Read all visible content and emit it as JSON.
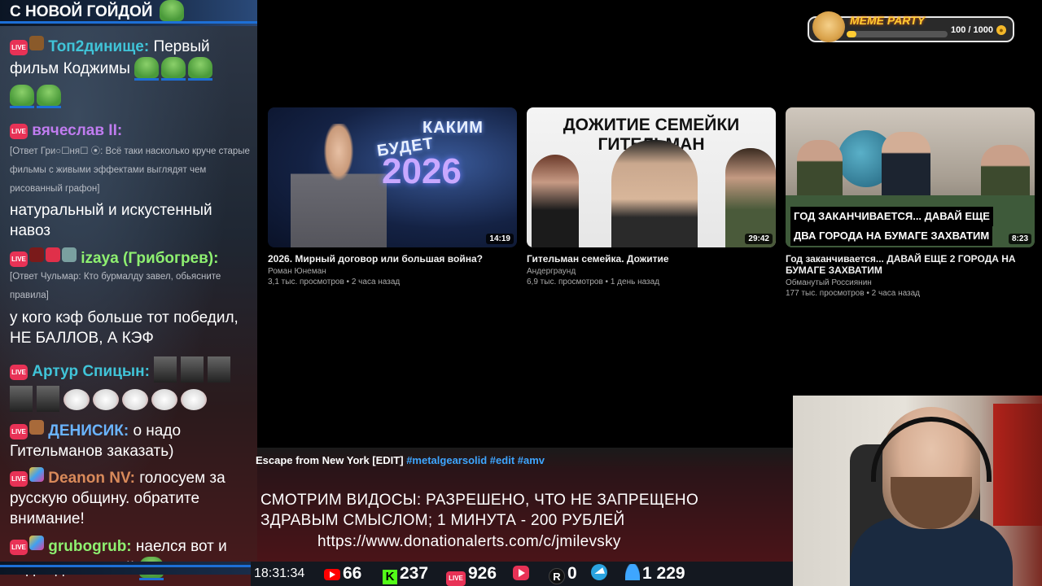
{
  "chat": {
    "pinned": "С НОВОЙ ГОЙДОЙ",
    "live_badge": "LIVE",
    "messages": [
      {
        "user": "Топ2динище:",
        "user_color": "#40c4d8",
        "text": "Первый фильм Коджимы"
      },
      {
        "user": "вячеслав II:",
        "user_color": "#c07cf0",
        "text": ""
      },
      {
        "reply": "[Ответ Гри○☐ня☐ ⦿: Всё таки насколько круче старые фильмы с живыми эффектами выглядят чем рисованный графон]",
        "text": "натуральный и искустенный навоз"
      },
      {
        "user": "izaya (Грибогрев):",
        "user_color": "#8ef070",
        "text": ""
      },
      {
        "reply": "[Ответ Чульмар: Кто бурмалду завел, обьясните правила]",
        "text": "у кого кэф больше тот победил, НЕ БАЛЛОВ, А КЭФ"
      },
      {
        "user": "Артур Спицын:",
        "user_color": "#40c4d8",
        "text": ""
      },
      {
        "user": "ДЕНИСИК:",
        "user_color": "#6ab4ff",
        "text": "о надо Гительманов заказать)"
      },
      {
        "user": "Deanon NV:",
        "user_color": "#d98a5a",
        "text": "голосуем за русскую общину. обратите внимание!"
      },
      {
        "user": "grubogrub:",
        "user_color": "#8ef070",
        "text": "наелся вот и сидит довольный"
      }
    ]
  },
  "meme_party": {
    "title": "MEME PARTY",
    "count": "100 / 1000",
    "progress": 0.1,
    "coin_icon": "coin-icon"
  },
  "videos": [
    {
      "title": "2026. Мирный договор или большая война?",
      "channel": "Роман Юнеман",
      "meta": "3,1 тыс. просмотров • 2 часа назад",
      "duration": "14:19",
      "thumb_text_1": "КАКИМ",
      "thumb_text_2": "БУДЕТ",
      "thumb_text_3": "2026"
    },
    {
      "title": "Гительман семейка. Дожитие",
      "channel": "Андерграунд",
      "meta": "6,9 тыс. просмотров • 1 день назад",
      "duration": "29:42",
      "thumb_text_1": "ДОЖИТИЕ СЕМЕЙКИ ГИТЕЛЬМАН"
    },
    {
      "title": "Год заканчивается... ДАВАЙ ЕЩЕ 2 ГОРОДА НА БУМАГЕ ЗАХВАТИМ",
      "channel": "Обманутый Россиянин",
      "meta": "177 тыс. просмотров • 2 часа назад",
      "duration": "8:23",
      "thumb_text_1": "ГОД ЗАКАНЧИВАЕТСЯ... ДАВАЙ ЕЩЕ",
      "thumb_text_2": "ДВА ГОРОДА НА БУМАГЕ ЗАХВАТИМ"
    }
  ],
  "now_playing": {
    "title": "Escape from New York [EDIT]",
    "tags": "#metalgearsolid #edit #amv"
  },
  "rules": {
    "line1": "СМОТРИМ ВИДОСЫ: РАЗРЕШЕНО, ЧТО НЕ ЗАПРЕЩЕНО",
    "line2": "ЗДРАВЫМ СМЫСЛОМ; 1 МИНУТА - 200 РУБЛЕЙ",
    "line3": "https://www.donationalerts.com/c/jmilevsky"
  },
  "status": {
    "time": "18:31:34",
    "youtube": "66",
    "kick": "237",
    "vk_live": "926",
    "vk_play": "",
    "rutube": "0",
    "telegram": "",
    "users": "1 229",
    "colors": {
      "youtube": "#ff0000",
      "kick": "#53fc18",
      "vk": "#e83256",
      "telegram": "#2aa3e0"
    }
  }
}
